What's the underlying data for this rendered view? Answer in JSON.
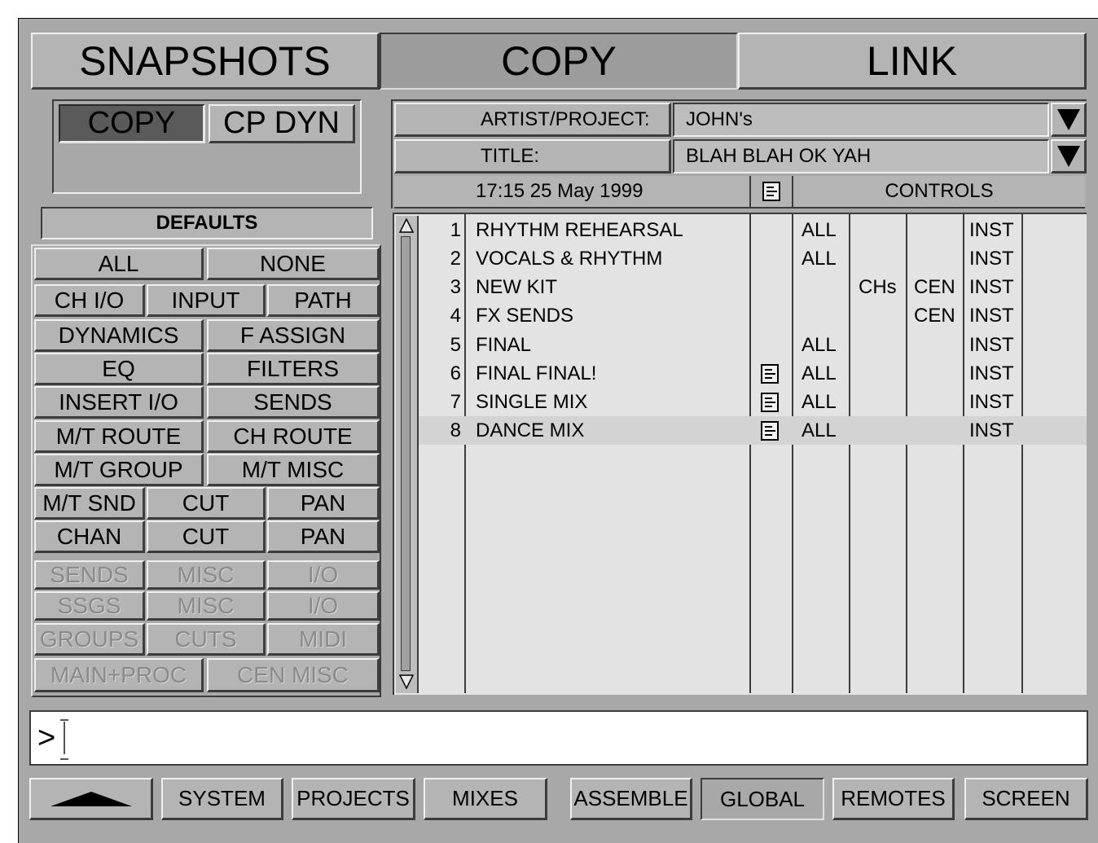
{
  "tabs": [
    {
      "label": "SNAPSHOTS",
      "selected": false
    },
    {
      "label": "COPY",
      "selected": true
    },
    {
      "label": "LINK",
      "selected": false
    }
  ],
  "mode_buttons": {
    "copy": "COPY",
    "cp_dyn": "CP DYN"
  },
  "defaults_label": "DEFAULTS",
  "left_buttons": {
    "all": "ALL",
    "none": "NONE",
    "ch_io": "CH I/O",
    "input": "INPUT",
    "path": "PATH",
    "dynamics": "DYNAMICS",
    "f_assign": "F ASSIGN",
    "eq": "EQ",
    "filters": "FILTERS",
    "insert_io": "INSERT I/O",
    "sends": "SENDS",
    "mt_route": "M/T ROUTE",
    "ch_route": "CH ROUTE",
    "mt_group": "M/T GROUP",
    "mt_misc": "M/T MISC",
    "mt_snd": "M/T SND",
    "cut1": "CUT",
    "pan1": "PAN",
    "chan": "CHAN",
    "cut2": "CUT",
    "pan2": "PAN"
  },
  "dim_buttons": {
    "sends": "SENDS",
    "misc1": "MISC",
    "io1": "I/O",
    "ssgs": "SSGS",
    "misc2": "MISC",
    "io2": "I/O",
    "groups": "GROUPS",
    "cuts": "CUTS",
    "midi": "MIDI",
    "main_proc": "MAIN+PROC",
    "cen_misc": "CEN MISC"
  },
  "fields": {
    "artist_label": "ARTIST/PROJECT:",
    "artist_value": "JOHN's",
    "title_label": "TITLE:",
    "title_value": "BLAH BLAH OK YAH"
  },
  "list_header": {
    "timestamp": "17:15 25 May 1999",
    "controls": "CONTROLS"
  },
  "rows": [
    {
      "num": "1",
      "name": "RHYTHM REHEARSAL",
      "note": false,
      "c1": "ALL",
      "c2": "",
      "c3": "",
      "c4": "INST"
    },
    {
      "num": "2",
      "name": "VOCALS & RHYTHM",
      "note": false,
      "c1": "ALL",
      "c2": "",
      "c3": "",
      "c4": "INST"
    },
    {
      "num": "3",
      "name": "NEW KIT",
      "note": false,
      "c1": "",
      "c2": "CHs",
      "c3": "CEN",
      "c4": "INST"
    },
    {
      "num": "4",
      "name": "FX SENDS",
      "note": false,
      "c1": "",
      "c2": "",
      "c3": "CEN",
      "c4": "INST"
    },
    {
      "num": "5",
      "name": "FINAL",
      "note": false,
      "c1": "ALL",
      "c2": "",
      "c3": "",
      "c4": "INST"
    },
    {
      "num": "6",
      "name": "FINAL FINAL!",
      "note": true,
      "c1": "ALL",
      "c2": "",
      "c3": "",
      "c4": "INST"
    },
    {
      "num": "7",
      "name": "SINGLE MIX",
      "note": true,
      "c1": "ALL",
      "c2": "",
      "c3": "",
      "c4": "INST"
    },
    {
      "num": "8",
      "name": "DANCE MIX",
      "note": true,
      "c1": "ALL",
      "c2": "",
      "c3": "",
      "c4": "INST"
    }
  ],
  "command_prompt": ">",
  "bottom_nav": {
    "system": "SYSTEM",
    "projects": "PROJECTS",
    "mixes": "MIXES",
    "assemble": "ASSEMBLE",
    "global": "GLOBAL",
    "remotes": "REMOTES",
    "screen": "SCREEN"
  }
}
